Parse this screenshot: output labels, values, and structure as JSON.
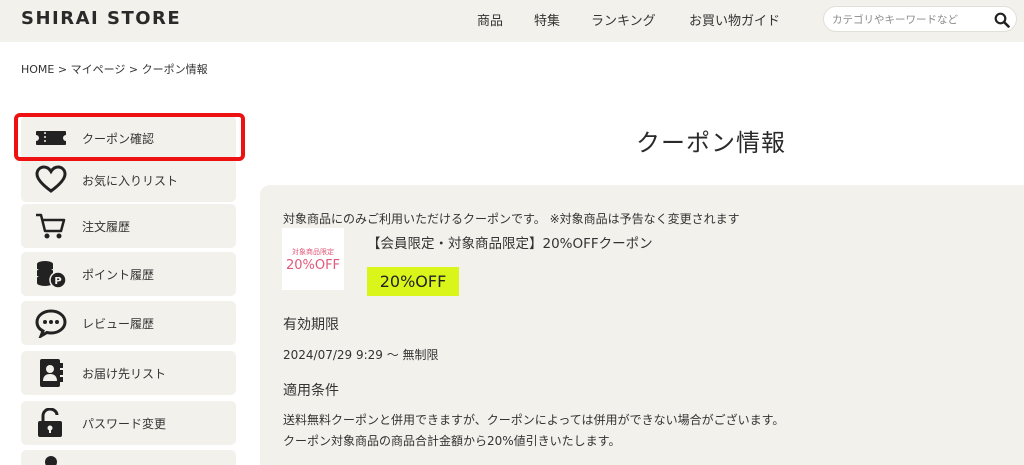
{
  "header": {
    "logo": "SHIRAI STORE",
    "nav": [
      "商品",
      "特集",
      "ランキング",
      "お買い物ガイド"
    ],
    "search_placeholder": "カテゴリやキーワードなど"
  },
  "breadcrumb": "HOME > マイページ > クーポン情報",
  "sidebar": {
    "items": [
      {
        "label": "クーポン確認",
        "icon": "ticket-icon"
      },
      {
        "label": "お気に入りリスト",
        "icon": "heart-icon"
      },
      {
        "label": "注文履歴",
        "icon": "cart-icon"
      },
      {
        "label": "ポイント履歴",
        "icon": "coins-icon"
      },
      {
        "label": "レビュー履歴",
        "icon": "chat-bubble-icon"
      },
      {
        "label": "お届け先リスト",
        "icon": "address-book-icon"
      },
      {
        "label": "パスワード変更",
        "icon": "lock-icon"
      }
    ]
  },
  "main": {
    "title": "クーポン情報",
    "coupon_note": "対象商品にのみご利用いただけるクーポンです。 ※対象商品は予告なく変更されます",
    "coupon_name": "【会員限定・対象商品限定】20%OFFクーポン",
    "coupon_image_small": "対象商品限定",
    "coupon_image_big": "20%OFF",
    "discount": "20%OFF",
    "validity_heading": "有効期限",
    "validity_value": "2024/07/29 9:29 〜 無制限",
    "conditions_heading": "適用条件",
    "conditions_line1": "送料無料クーポンと併用できますが、クーポンによっては併用ができない場合がございます。",
    "conditions_line2": "クーポン対象商品の商品合計金額から20%値引きいたします。"
  },
  "colors": {
    "background_beige": "#f3f1ec",
    "highlight_red": "#ee1111",
    "discount_lime": "#d9f51a",
    "coupon_pink": "#e0597a"
  }
}
